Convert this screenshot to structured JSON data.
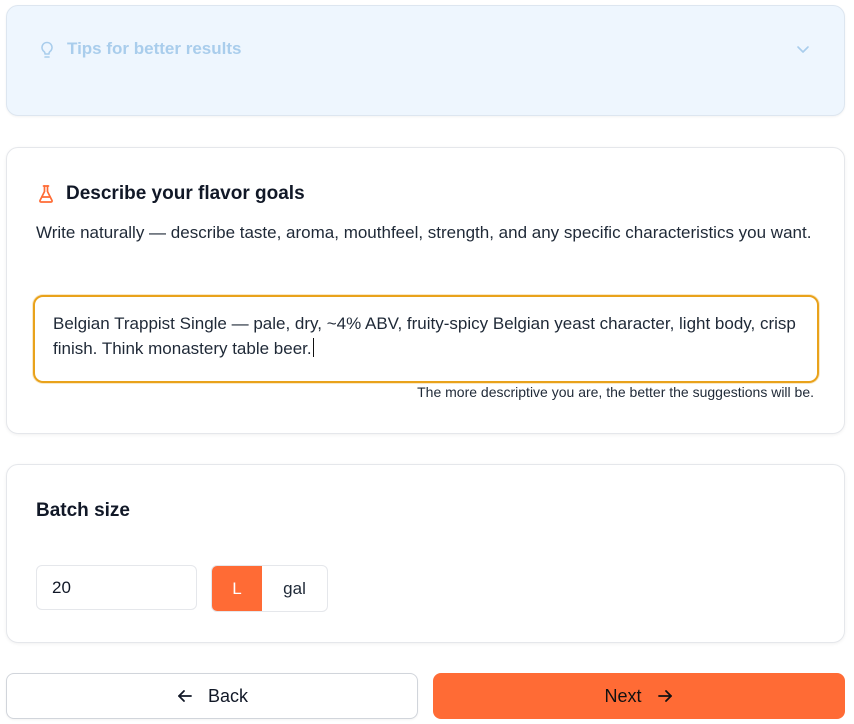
{
  "tips": {
    "title": "Tips for better results",
    "icon": "lightbulb-icon",
    "chevron_icon": "chevron-down-icon",
    "expanded": false
  },
  "flavor": {
    "icon": "flask-icon",
    "title": "Describe your flavor goals",
    "description": "Write naturally — describe taste, aroma, mouthfeel, strength, and any specific characteristics you want.",
    "input_value": "Belgian Trappist Single — pale, dry, ~4% ABV, fruity-spicy Belgian yeast character, light body, crisp finish. Think monastery table beer.",
    "helper": "The more descriptive you are, the better the suggestions will be."
  },
  "batch": {
    "title": "Batch size",
    "value": "20",
    "units": [
      "L",
      "gal"
    ],
    "selected_unit": "L"
  },
  "nav": {
    "back_label": "Back",
    "next_label": "Next"
  },
  "colors": {
    "accent": "#ff6b35",
    "focus_ring": "#e9a21b",
    "tips_bg": "#eef6fe",
    "tips_text": "#a9cdec"
  }
}
